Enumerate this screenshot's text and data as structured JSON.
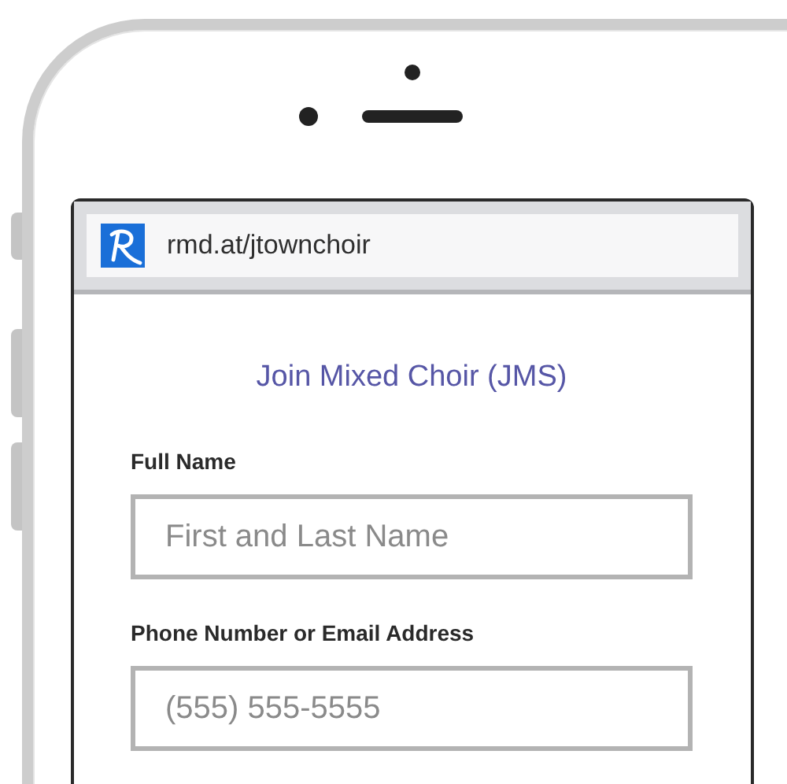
{
  "browser": {
    "url": "rmd.at/jtownchoir"
  },
  "form": {
    "title": "Join Mixed Choir (JMS)",
    "fields": [
      {
        "label": "Full Name",
        "placeholder": "First and Last Name"
      },
      {
        "label": "Phone Number or Email Address",
        "placeholder": "(555) 555-5555"
      }
    ]
  }
}
